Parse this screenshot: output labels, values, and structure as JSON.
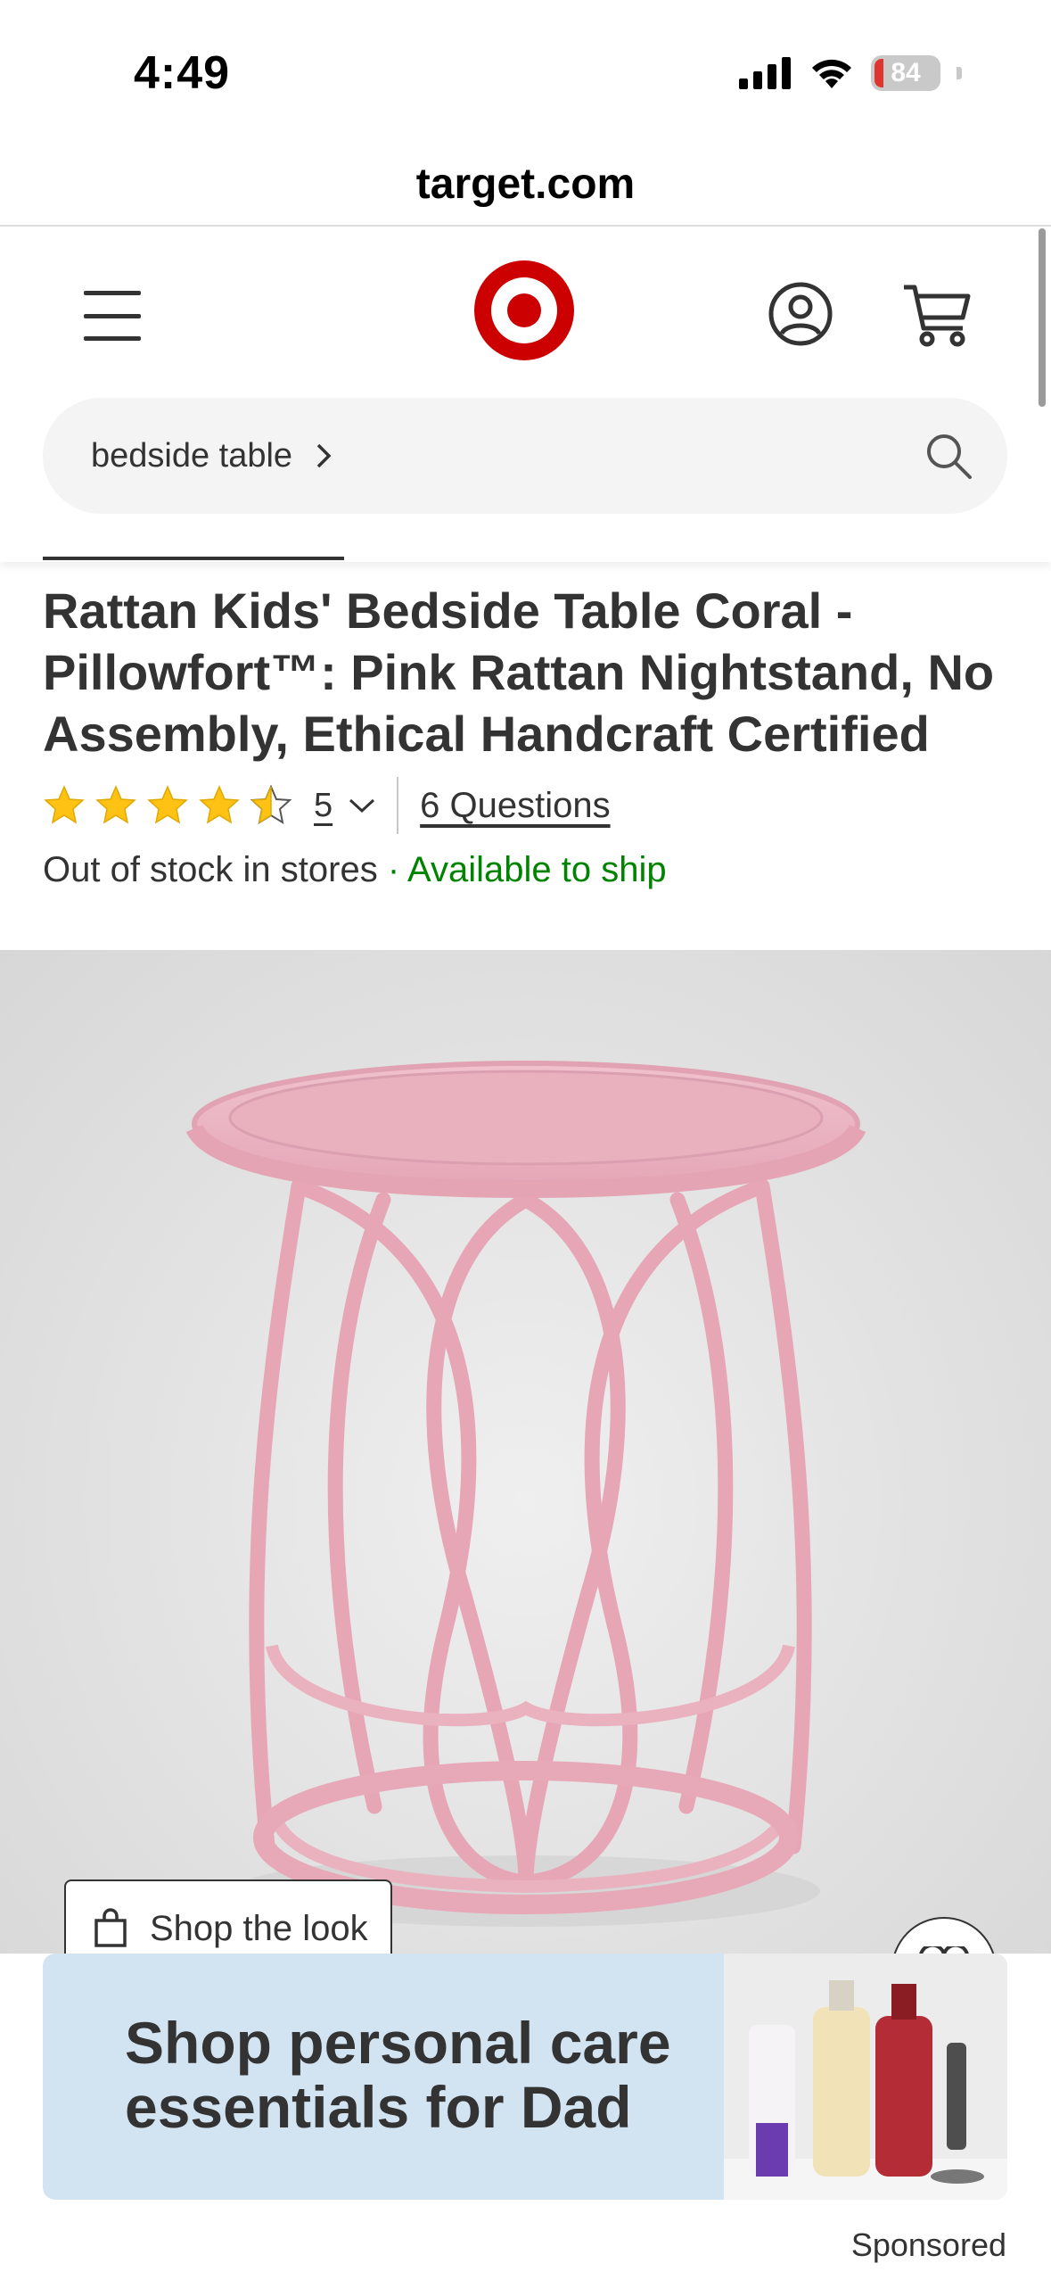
{
  "status_bar": {
    "time": "4:49",
    "battery": "84"
  },
  "browser": {
    "url": "target.com"
  },
  "header": {
    "search_chip": "bedside table"
  },
  "product": {
    "title": "Rattan Kids' Bedside Table Coral - Pillowfort™: Pink Rattan Nightstand, No Assembly, Ethical Handcraft Certified",
    "rating_value": 4.5,
    "rating_count": "5",
    "questions": "6 Questions",
    "stock_store": "Out of stock in stores",
    "stock_separator": " · ",
    "stock_ship": "Available to ship"
  },
  "image": {
    "shop_the_look": "Shop the look"
  },
  "ad": {
    "headline": "Shop personal care essentials for Dad",
    "sponsored": "Sponsored"
  },
  "colors": {
    "brand_red": "#cc0000",
    "link_green": "#008300",
    "star_gold": "#fdc214",
    "table_pink": "#ebb2c0"
  }
}
